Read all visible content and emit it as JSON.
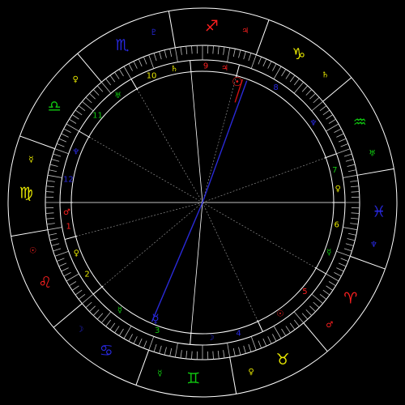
{
  "colors": {
    "background": "#000000",
    "wheel_lines": "#ffffff",
    "tick_lines": "#bfbfbf",
    "aspect_line_dotted": "#a0a0a0",
    "aspect_blue": "#2a2ad8",
    "aspect_red": "#d01010"
  },
  "signs": [
    {
      "name": "sagittarius",
      "glyph": "♐",
      "color": "#ff2020",
      "ruler": "♃",
      "ruler_color": "#ff2020"
    },
    {
      "name": "capricorn",
      "glyph": "♑",
      "color": "#e8e800",
      "ruler": "♄",
      "ruler_color": "#e8e800"
    },
    {
      "name": "aquarius",
      "glyph": "♒",
      "color": "#10c810",
      "ruler": "♅",
      "ruler_color": "#10c810"
    },
    {
      "name": "pisces",
      "glyph": "♓",
      "color": "#2828e0",
      "ruler": "♆",
      "ruler_color": "#2828e0"
    },
    {
      "name": "aries",
      "glyph": "♈",
      "color": "#ff2020",
      "ruler": "♂",
      "ruler_color": "#ff2020"
    },
    {
      "name": "taurus",
      "glyph": "♉",
      "color": "#e8e800",
      "ruler": "♀",
      "ruler_color": "#e8e800"
    },
    {
      "name": "gemini",
      "glyph": "♊",
      "color": "#10c810",
      "ruler": "☿",
      "ruler_color": "#10c810"
    },
    {
      "name": "cancer",
      "glyph": "♋",
      "color": "#2828e0",
      "ruler": "☽",
      "ruler_color": "#2828e0"
    },
    {
      "name": "leo",
      "glyph": "♌",
      "color": "#ff2020",
      "ruler": "☉",
      "ruler_color": "#ff2020"
    },
    {
      "name": "virgo",
      "glyph": "♍",
      "color": "#e8e800",
      "ruler": "☿",
      "ruler_color": "#e8e800"
    },
    {
      "name": "libra",
      "glyph": "♎",
      "color": "#10c810",
      "ruler": "♀",
      "ruler_color": "#e8e800"
    },
    {
      "name": "scorpio",
      "glyph": "♏",
      "color": "#2828e0",
      "ruler": "♇",
      "ruler_color": "#2828e0"
    }
  ],
  "houses": [
    {
      "number": "1",
      "color": "#ff2020",
      "ruler": "♂",
      "ruler_color": "#ff2020"
    },
    {
      "number": "2",
      "color": "#e8e800",
      "ruler": "♀",
      "ruler_color": "#e8e800"
    },
    {
      "number": "3",
      "color": "#10c810",
      "ruler": "☿",
      "ruler_color": "#10c810"
    },
    {
      "number": "4",
      "color": "#2828e0",
      "ruler": "☽",
      "ruler_color": "#2828e0"
    },
    {
      "number": "5",
      "color": "#ff2020",
      "ruler": "☉",
      "ruler_color": "#ff2020"
    },
    {
      "number": "6",
      "color": "#e8e800",
      "ruler": "☿",
      "ruler_color": "#10c810"
    },
    {
      "number": "7",
      "color": "#10c810",
      "ruler": "♀",
      "ruler_color": "#e8e800"
    },
    {
      "number": "8",
      "color": "#2828e0",
      "ruler": "♆",
      "ruler_color": "#2828e0"
    },
    {
      "number": "9",
      "color": "#ff2020",
      "ruler": "♃",
      "ruler_color": "#ff2020"
    },
    {
      "number": "10",
      "color": "#e8e800",
      "ruler": "♄",
      "ruler_color": "#e8e800"
    },
    {
      "number": "11",
      "color": "#10c810",
      "ruler": "♅",
      "ruler_color": "#10c810"
    },
    {
      "number": "12",
      "color": "#2828e0",
      "ruler": "♆",
      "ruler_color": "#2828e0"
    }
  ],
  "planets": [
    {
      "name": "sun",
      "glyph": "☉",
      "color": "#ff2020"
    },
    {
      "name": "mercury",
      "glyph": "☿",
      "color": "#2828e0"
    }
  ]
}
